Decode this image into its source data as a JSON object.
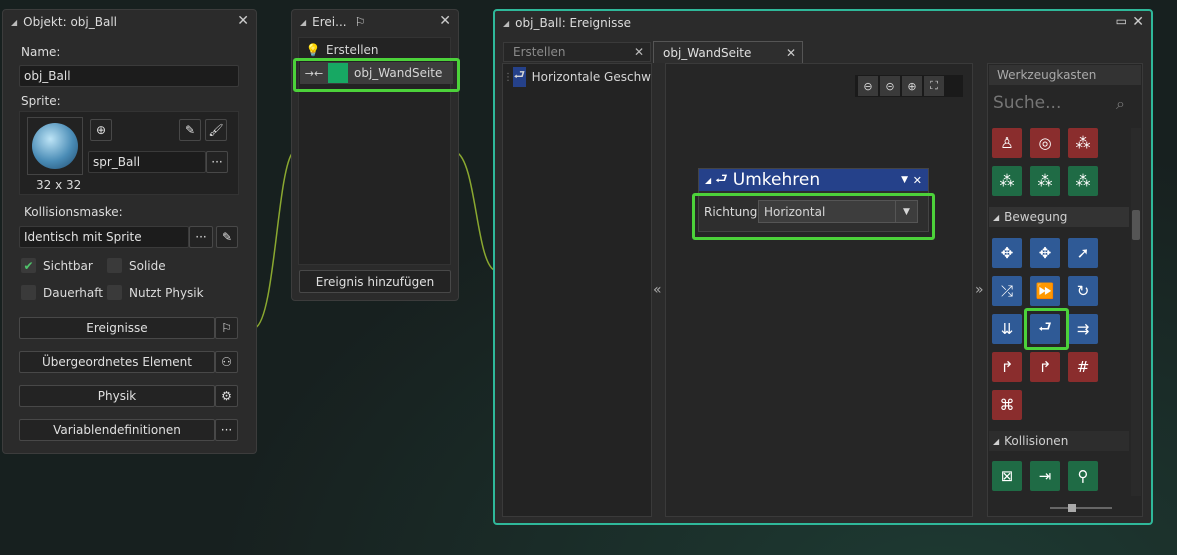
{
  "object_panel": {
    "title": "Objekt: obj_Ball",
    "name_label": "Name:",
    "name_value": "obj_Ball",
    "sprite_label": "Sprite:",
    "sprite_name": "spr_Ball",
    "sprite_size": "32 x 32",
    "mask_label": "Kollisionsmaske:",
    "mask_value": "Identisch mit Sprite",
    "visible_label": "Sichtbar",
    "solid_label": "Solide",
    "persistent_label": "Dauerhaft",
    "physics_label": "Nutzt Physik",
    "events_button": "Ereignisse",
    "parent_button": "Übergeordnetes Element",
    "physics_button": "Physik",
    "variables_button": "Variablendefinitionen",
    "more": "···"
  },
  "events_panel": {
    "title": "Erei...",
    "items": [
      {
        "label": "Erstellen"
      },
      {
        "label": "obj_WandSeite"
      }
    ],
    "add_button": "Ereignis hinzufügen"
  },
  "editor_panel": {
    "title": "obj_Ball: Ereignisse",
    "tabs": [
      {
        "label": "Erstellen"
      },
      {
        "label": "obj_WandSeite"
      }
    ],
    "action_list": [
      {
        "label": "Horizontale Geschw"
      }
    ],
    "action_block": {
      "title": "Umkehren",
      "param_label": "Richtung",
      "param_value": "Horizontal"
    },
    "collapse_left": "«",
    "collapse_right": "»"
  },
  "toolbox": {
    "title": "Werkzeugkasten",
    "search_placeholder": "Suche...",
    "section_movement": "Bewegung",
    "section_collisions": "Kollisionen"
  },
  "colors": {
    "highlight": "#4cd23a",
    "action_header": "#25418a",
    "tool_red": "#8a2d2d",
    "tool_green": "#1f6b45",
    "tool_blue": "#2f5a96"
  }
}
